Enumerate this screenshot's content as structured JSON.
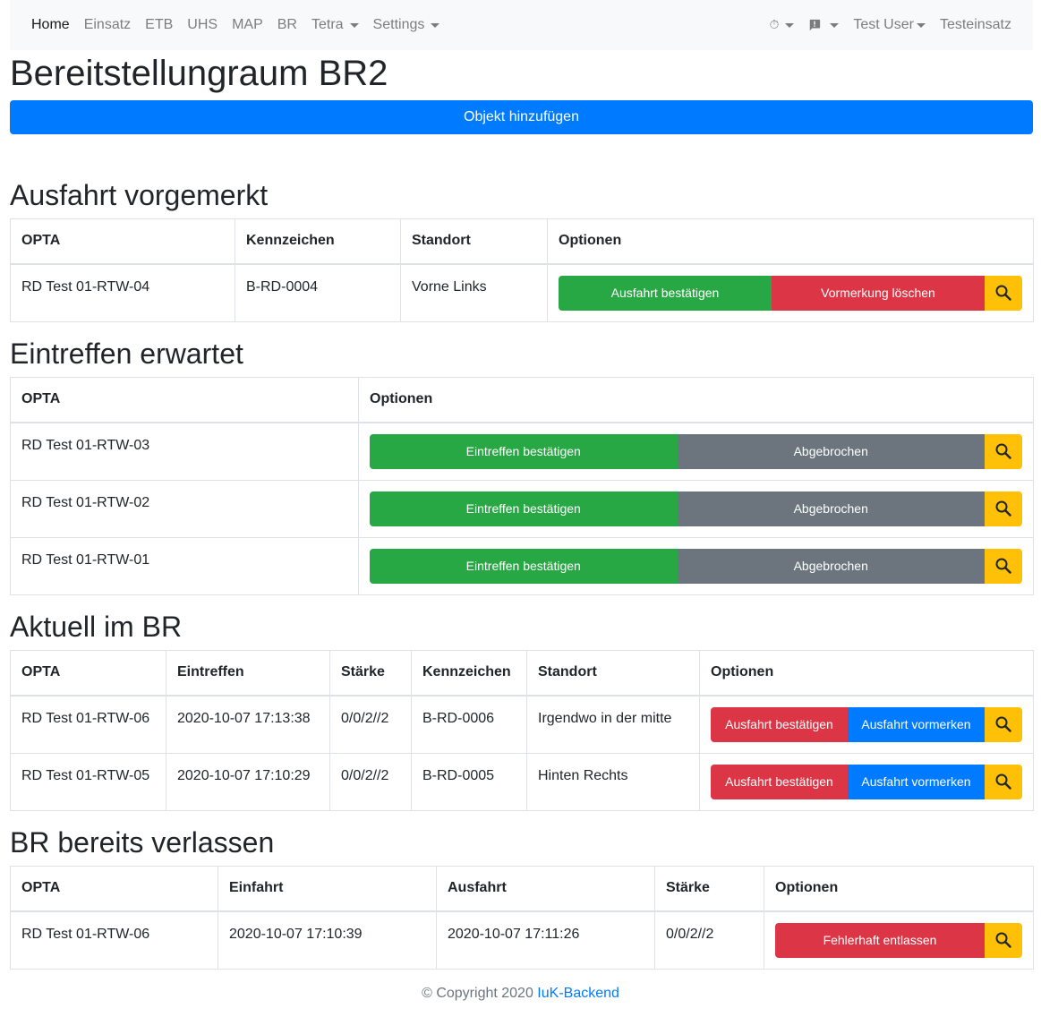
{
  "nav": {
    "items": [
      "Home",
      "Einsatz",
      "ETB",
      "UHS",
      "MAP",
      "BR"
    ],
    "tetra": "Tetra",
    "settings": "Settings",
    "timer_icon": "⏱",
    "message_icon": "message-alert-icon",
    "user": "Test User",
    "einsatz": "Testeinsatz"
  },
  "page_title": "Bereitstellungraum BR2",
  "add_button": "Objekt hinzufügen",
  "sections": {
    "vorgemerkt": {
      "title": "Ausfahrt vorgemerkt",
      "headers": [
        "OPTA",
        "Kennzeichen",
        "Standort",
        "Optionen"
      ],
      "rows": [
        {
          "opta": "RD Test 01-RTW-04",
          "kennzeichen": "B-RD-0004",
          "standort": "Vorne Links"
        }
      ],
      "btn1": "Ausfahrt bestätigen",
      "btn2": "Vormerkung löschen"
    },
    "erwartet": {
      "title": "Eintreffen erwartet",
      "headers": [
        "OPTA",
        "Optionen"
      ],
      "rows": [
        {
          "opta": "RD Test 01-RTW-03"
        },
        {
          "opta": "RD Test 01-RTW-02"
        },
        {
          "opta": "RD Test 01-RTW-01"
        }
      ],
      "btn1": "Eintreffen bestätigen",
      "btn2": "Abgebrochen"
    },
    "aktuell": {
      "title": "Aktuell im BR",
      "headers": [
        "OPTA",
        "Eintreffen",
        "Stärke",
        "Kennzeichen",
        "Standort",
        "Optionen"
      ],
      "rows": [
        {
          "opta": "RD Test 01-RTW-06",
          "eintreffen": "2020-10-07 17:13:38",
          "staerke": "0/0/2//2",
          "kennzeichen": "B-RD-0006",
          "standort": "Irgendwo in der mitte"
        },
        {
          "opta": "RD Test 01-RTW-05",
          "eintreffen": "2020-10-07 17:10:29",
          "staerke": "0/0/2//2",
          "kennzeichen": "B-RD-0005",
          "standort": "Hinten Rechts"
        }
      ],
      "btn1": "Ausfahrt bestätigen",
      "btn2": "Ausfahrt vormerken"
    },
    "verlassen": {
      "title": "BR bereits verlassen",
      "headers": [
        "OPTA",
        "Einfahrt",
        "Ausfahrt",
        "Stärke",
        "Optionen"
      ],
      "rows": [
        {
          "opta": "RD Test 01-RTW-06",
          "einfahrt": "2020-10-07 17:10:39",
          "ausfahrt": "2020-10-07 17:11:26",
          "staerke": "0/0/2//2"
        }
      ],
      "btn1": "Fehlerhaft entlassen"
    }
  },
  "footer": {
    "copyright": "© Copyright 2020 ",
    "link": "IuK-Backend"
  },
  "colors": {
    "primary": "#007bff",
    "success": "#28a745",
    "danger": "#dc3545",
    "secondary": "#6c757d",
    "warning": "#ffc107"
  }
}
